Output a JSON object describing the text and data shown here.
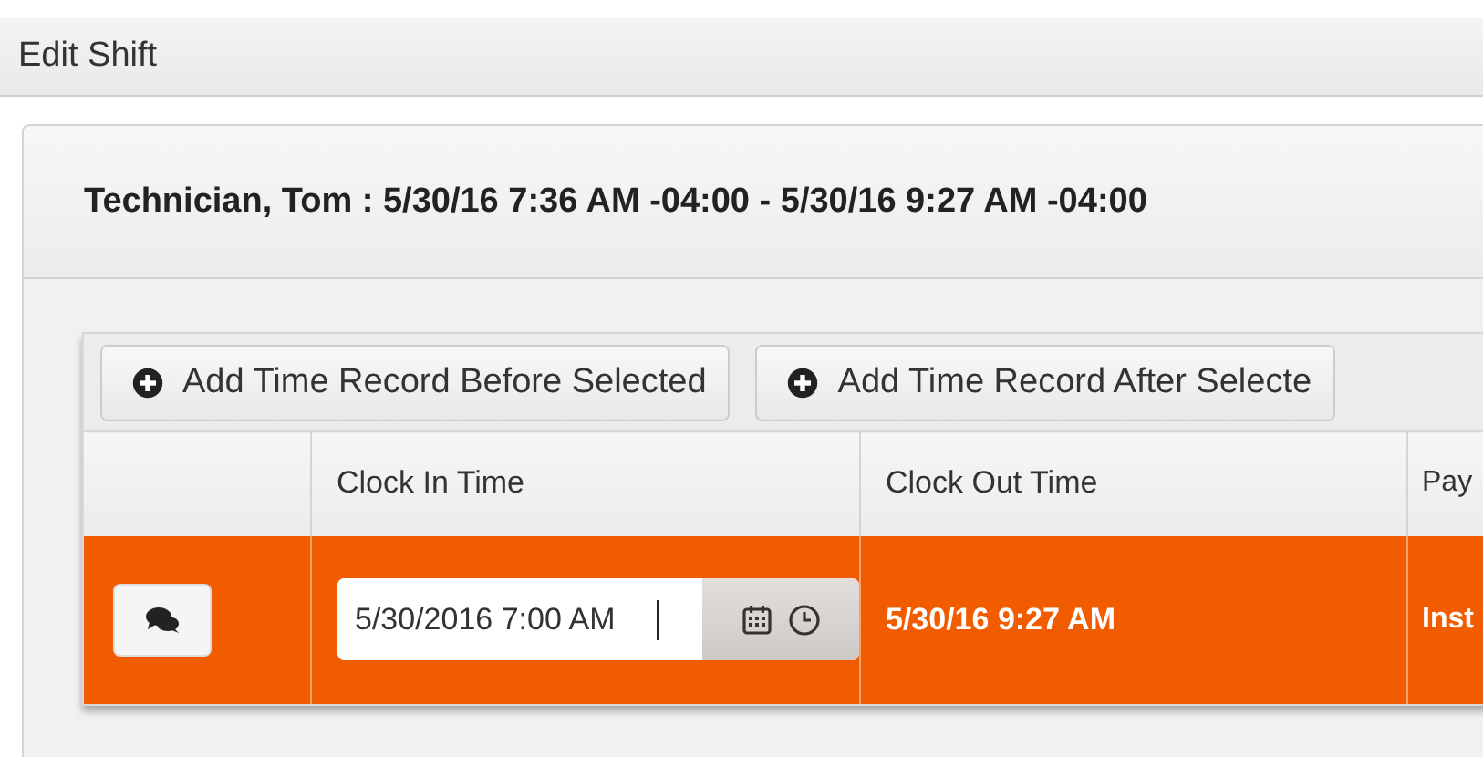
{
  "window": {
    "title": "Edit Shift"
  },
  "panel": {
    "title": "Technician, Tom : 5/30/16 7:36 AM -04:00 - 5/30/16 9:27 AM -04:00"
  },
  "toolbar": [
    "Add Time Record Before Selected",
    "Add Time Record After Selecte"
  ],
  "table": {
    "columns": [
      "",
      "Clock In Time",
      "Clock Out Time",
      "Pay"
    ],
    "rows": [
      {
        "selected": true,
        "clock_in": "5/30/2016 7:00 AM",
        "clock_out": "5/30/16 9:27 AM",
        "column_4": "Inst"
      }
    ]
  }
}
